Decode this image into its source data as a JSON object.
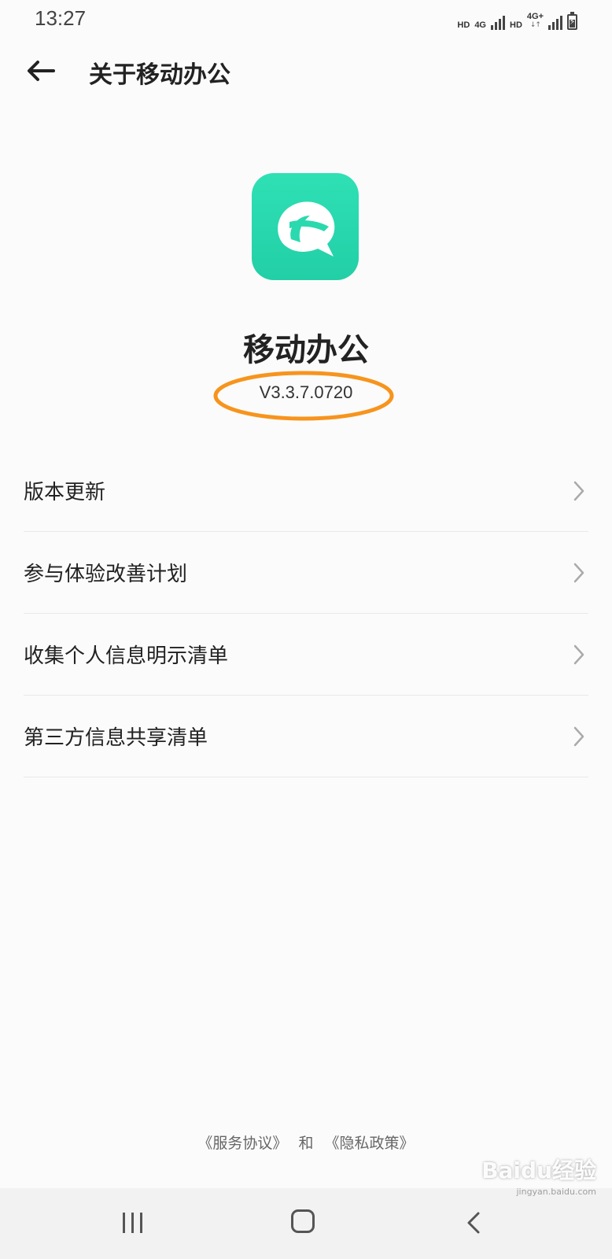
{
  "status_bar": {
    "time": "13:27",
    "sim1_hd": "HD",
    "sim1_net": "4G",
    "sim2_hd": "HD",
    "sim2_net": "4G+",
    "battery_charging": "⚡"
  },
  "header": {
    "back_icon": "arrow-left-icon",
    "title": "关于移动办公"
  },
  "app": {
    "icon": "app-logo-icon",
    "icon_color": "#2bd9ae",
    "name": "移动办公",
    "version": "V3.3.7.0720",
    "annotation_color": "#f7941d"
  },
  "menu": {
    "items": [
      {
        "label": "版本更新"
      },
      {
        "label": "参与体验改善计划"
      },
      {
        "label": "收集个人信息明示清单"
      },
      {
        "label": "第三方信息共享清单"
      }
    ]
  },
  "footer": {
    "service_agreement": "《服务协议》",
    "and": "和",
    "privacy_policy": "《隐私政策》"
  },
  "watermark": {
    "text": "Baidu经验",
    "url": "jingyan.baidu.com"
  }
}
